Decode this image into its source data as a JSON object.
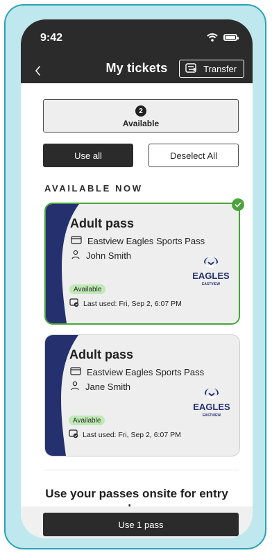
{
  "status": {
    "time": "9:42"
  },
  "nav": {
    "title": "My tickets",
    "transfer_label": "Transfer"
  },
  "summary": {
    "count": "2",
    "label": "Available"
  },
  "actions": {
    "use_all": "Use all",
    "deselect_all": "Deselect All"
  },
  "section": {
    "heading": "AVAILABLE NOW"
  },
  "tickets": [
    {
      "title": "Adult pass",
      "pass_name": "Eastview Eagles Sports Pass",
      "holder": "John Smith",
      "status": "Available",
      "last_used": "Last used: Fri, Sep 2, 6:07 PM",
      "selected": true,
      "logo_text": "EAGLES",
      "logo_subtext": "EASTVIEW"
    },
    {
      "title": "Adult pass",
      "pass_name": "Eastview Eagles Sports Pass",
      "holder": "Jane Smith",
      "status": "Available",
      "last_used": "Last used: Fri, Sep 2, 6:07 PM",
      "selected": false,
      "logo_text": "EAGLES",
      "logo_subtext": "EASTVIEW"
    }
  ],
  "footer": {
    "onsite_text_line1": "Use your passes onsite for entry",
    "onsite_text_line2": "and more",
    "use_pass_label": "Use 1 pass"
  },
  "colors": {
    "frame_bg": "#bfe7ee",
    "frame_border": "#2aa3b3",
    "dark": "#2b2b2b",
    "ticket_stripe": "#25306f",
    "selected_green": "#4aa43b",
    "available_pill": "#bfe9b5"
  }
}
